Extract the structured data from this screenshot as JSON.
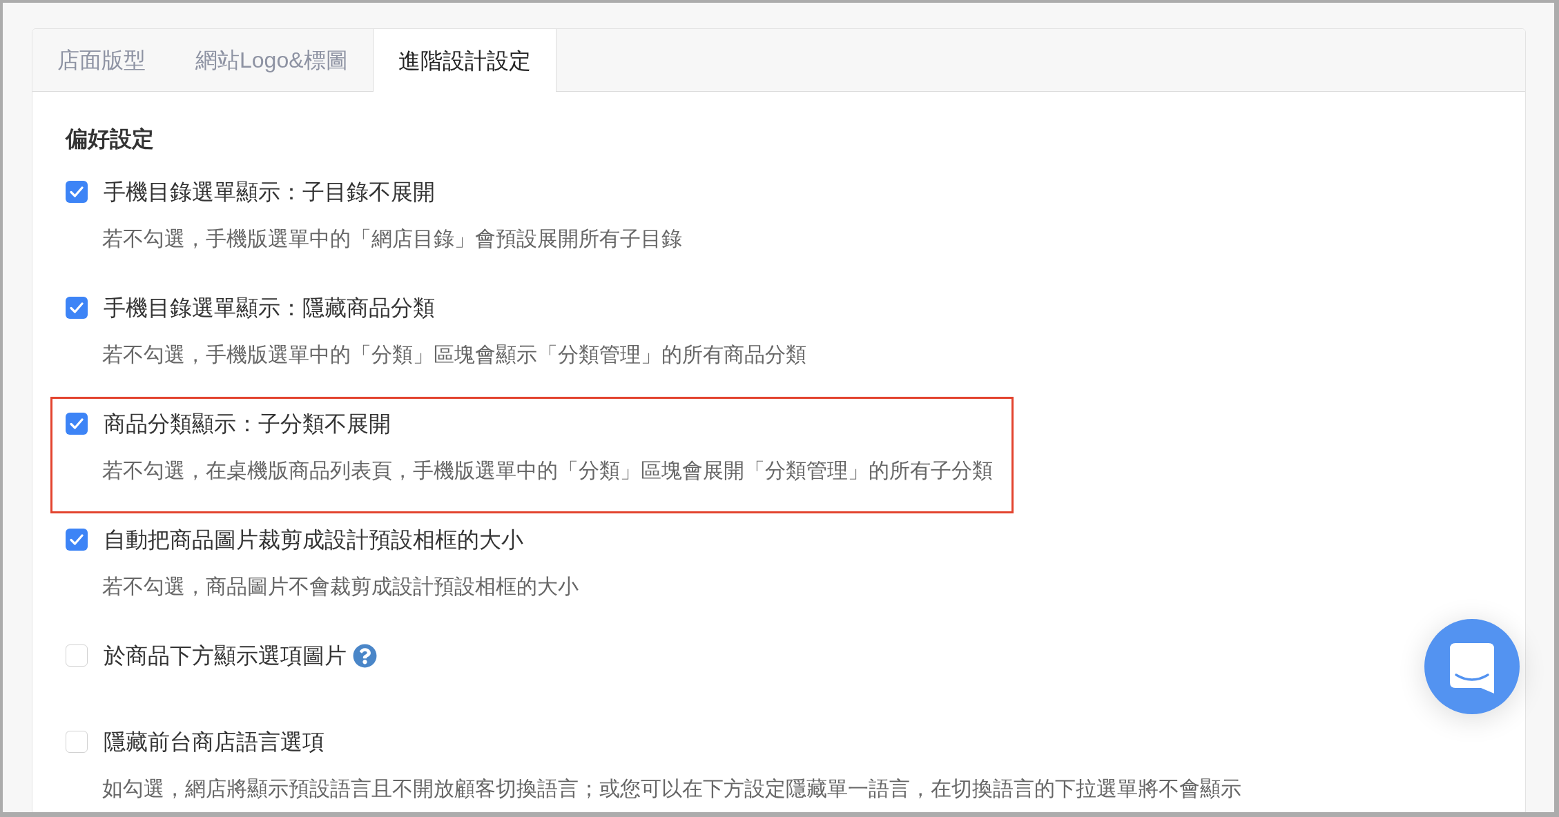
{
  "tabs": [
    {
      "label": "店面版型",
      "selected": false
    },
    {
      "label": "網站Logo&標圖",
      "selected": false
    },
    {
      "label": "進階設計設定",
      "selected": true
    }
  ],
  "section": {
    "title": "偏好設定",
    "options": [
      {
        "label": "手機目錄選單顯示：子目錄不展開",
        "checked": true,
        "highlighted": false,
        "description": "若不勾選，手機版選單中的「網店目錄」會預設展開所有子目錄"
      },
      {
        "label": "手機目錄選單顯示：隱藏商品分類",
        "checked": true,
        "highlighted": false,
        "description": "若不勾選，手機版選單中的「分類」區塊會顯示「分類管理」的所有商品分類"
      },
      {
        "label": "商品分類顯示：子分類不展開",
        "checked": true,
        "highlighted": true,
        "description": "若不勾選，在桌機版商品列表頁，手機版選單中的「分類」區塊會展開「分類管理」的所有子分類"
      },
      {
        "label": "自動把商品圖片裁剪成設計預設相框的大小",
        "checked": true,
        "highlighted": false,
        "description": "若不勾選，商品圖片不會裁剪成設計預設相框的大小"
      },
      {
        "label": "於商品下方顯示選項圖片",
        "checked": false,
        "highlighted": false,
        "help": true
      },
      {
        "label": "隱藏前台商店語言選項",
        "checked": false,
        "highlighted": false,
        "description": "如勾選，網店將顯示預設語言且不開放顧客切換語言；或您可以在下方設定隱藏單一語言，在切換語言的下拉選單將不會顯示"
      }
    ]
  }
}
